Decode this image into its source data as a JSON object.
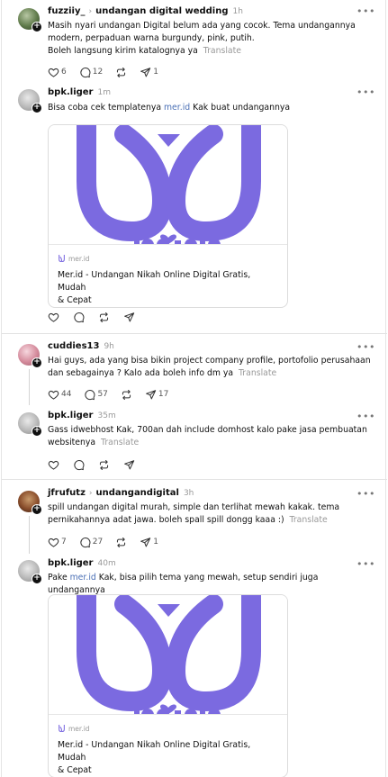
{
  "posts": [
    {
      "username": "fuzziiy_",
      "topic": "undangan digital wedding",
      "time": "1h",
      "lines": [
        "Masih nyari undangan Digital belum ada yang cocok. Tema undangannya",
        "modern, perpaduan warna burgundy, pink, putih.",
        "Boleh langsung kirim katalognya ya"
      ],
      "translate": "Translate",
      "likes": "6",
      "replies": "12",
      "shares": "1"
    },
    {
      "username": "bpk.liger",
      "time": "1m",
      "text_before": "Bisa coba cek templatenya ",
      "link": "mer.id",
      "text_after": " Kak buat undangannya",
      "card": {
        "domain": "mer.id",
        "title_lines": [
          "Mer.id - Undangan Nikah Online Digital Gratis, Mudah",
          "& Cepat"
        ]
      }
    },
    {
      "username": "cuddies13",
      "time": "9h",
      "lines": [
        "Hai guys, ada yang bisa bikin project company profile, portofolio perusahaan",
        "dan sebagainya ? Kalo ada boleh info dm ya"
      ],
      "translate": "Translate",
      "likes": "44",
      "replies": "57",
      "shares": "17"
    },
    {
      "username": "bpk.liger",
      "time": "35m",
      "lines": [
        "Gass idwebhost Kak, 700an dah include domhost kalo pake jasa pembuatan",
        "websitenya"
      ],
      "translate": "Translate"
    },
    {
      "username": "jfrufutz",
      "topic": "undangandigital",
      "time": "3h",
      "lines": [
        "spill undangan digital murah, simple dan terlihat mewah kakak. tema",
        "pernikahannya adat jawa. boleh spall spill dongg kaaa :)"
      ],
      "translate": "Translate",
      "likes": "7",
      "replies": "27",
      "shares": "1"
    },
    {
      "username": "bpk.liger",
      "time": "40m",
      "text_before": "Pake ",
      "link": "mer.id",
      "text_after": " Kak, bisa pilih tema yang mewah, setup sendiri juga undangannya",
      "card": {
        "domain": "mer.id",
        "title_lines": [
          "Mer.id - Undangan Nikah Online Digital Gratis, Mudah",
          "& Cepat"
        ]
      }
    }
  ],
  "more_glyph": "•••",
  "colors": {
    "brand_purple": "#7b6ae0",
    "link": "#4a6fb5",
    "muted": "#999999"
  },
  "icons": [
    "heart-icon",
    "comment-icon",
    "repost-icon",
    "share-icon",
    "more-icon",
    "follow-plus-icon"
  ]
}
